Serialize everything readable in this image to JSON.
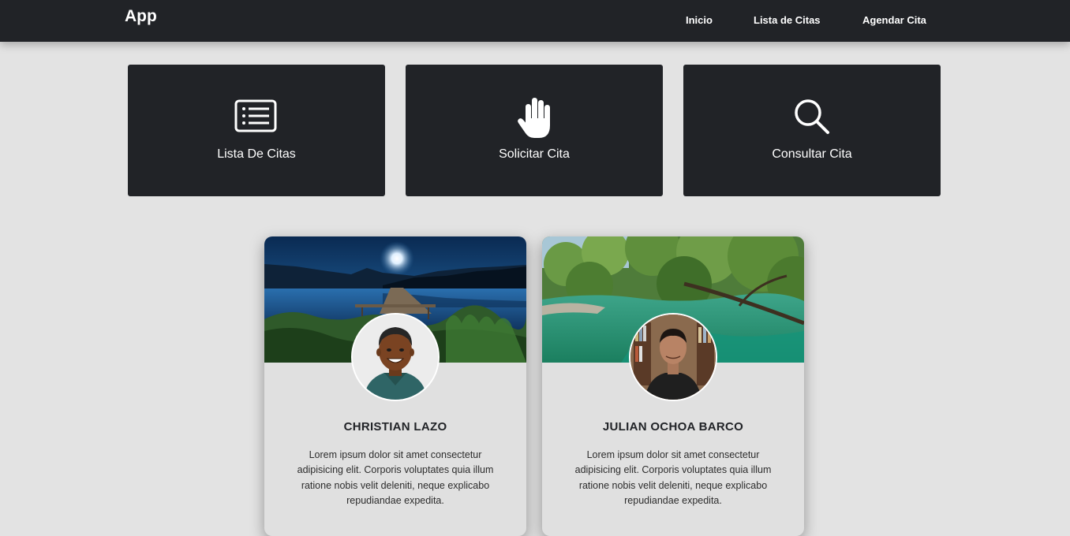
{
  "navbar": {
    "brand": "App",
    "links": [
      {
        "label": "Inicio"
      },
      {
        "label": "Lista de Citas"
      },
      {
        "label": "Agendar Cita"
      }
    ]
  },
  "tiles": [
    {
      "label": "Lista De Citas",
      "icon": "list-icon"
    },
    {
      "label": "Solicitar Cita",
      "icon": "hand-icon"
    },
    {
      "label": "Consultar Cita",
      "icon": "search-icon"
    }
  ],
  "cards": [
    {
      "name": "CHRISTIAN LAZO",
      "text": "Lorem ipsum dolor sit amet consectetur adipisicing elit. Corporis voluptates quia illum ratione nobis velit deleniti, neque explicabo repudiandae expedita.",
      "cover": "night-lake-pier",
      "avatar": "cartoon-avatar"
    },
    {
      "name": "JULIAN OCHOA BARCO",
      "text": "Lorem ipsum dolor sit amet consectetur adipisicing elit. Corporis voluptates quia illum ratione nobis velit deleniti, neque explicabo repudiandae expedita.",
      "cover": "jungle-river",
      "avatar": "photo-avatar"
    }
  ],
  "colors": {
    "navbar_bg": "#212327",
    "page_bg": "#e3e3e3",
    "tile_bg": "#212327",
    "card_bg": "#e0e0e0",
    "text_light": "#ffffff",
    "text_dark": "#212327"
  }
}
